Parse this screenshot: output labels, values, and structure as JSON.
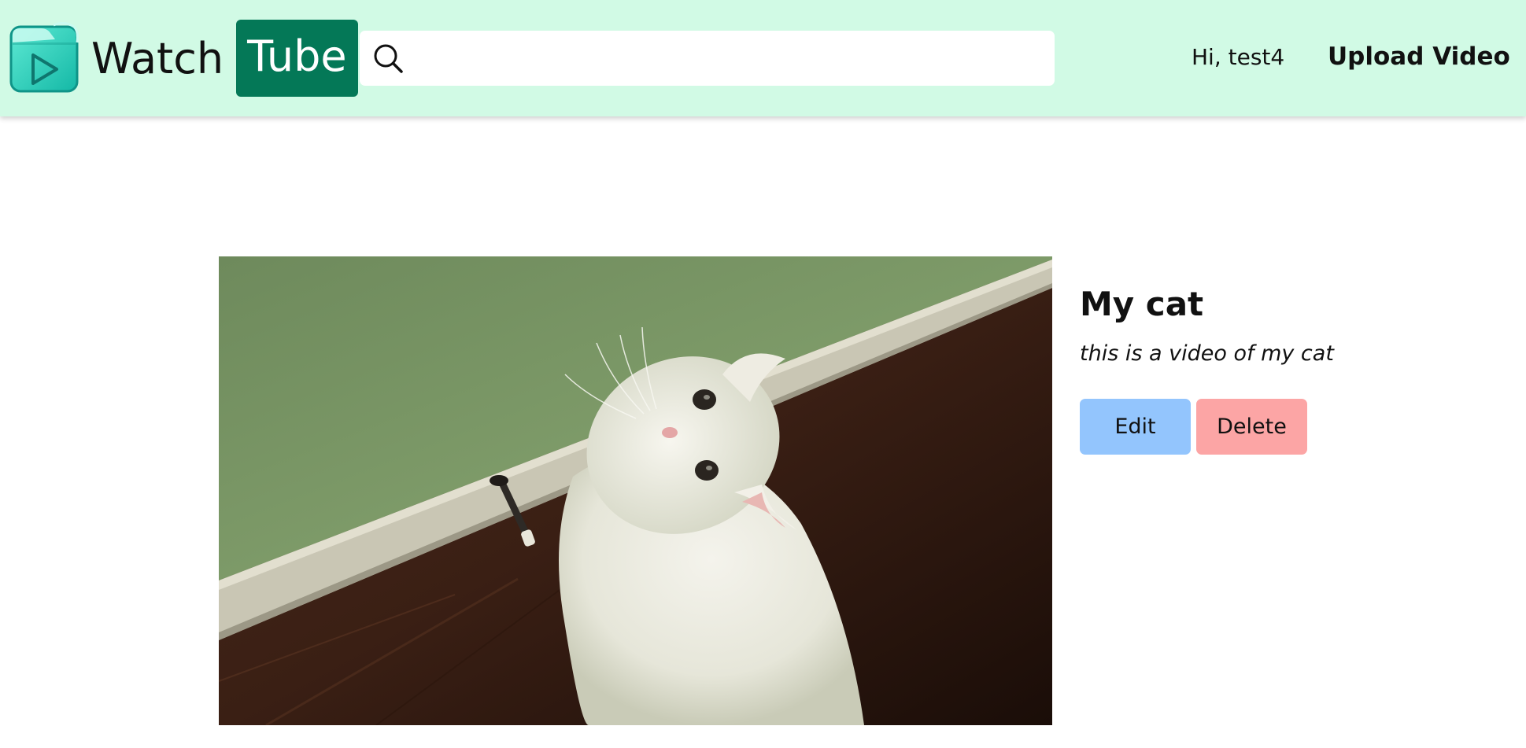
{
  "header": {
    "logo_part1": "Watch",
    "logo_part2": "Tube",
    "search": {
      "value": "",
      "placeholder": ""
    },
    "greeting": "Hi, test4",
    "upload_label": "Upload Video"
  },
  "video": {
    "title": "My cat",
    "description": "this is a video of my cat",
    "edit_label": "Edit",
    "delete_label": "Delete"
  },
  "colors": {
    "navbar_bg": "#d1fae5",
    "brand_green": "#047857",
    "logo_icon_teal": "#2dd4bf",
    "edit_button": "#93c5fd",
    "delete_button": "#fca5a5"
  },
  "icons": [
    "watchtube-logo-icon",
    "search-icon"
  ]
}
